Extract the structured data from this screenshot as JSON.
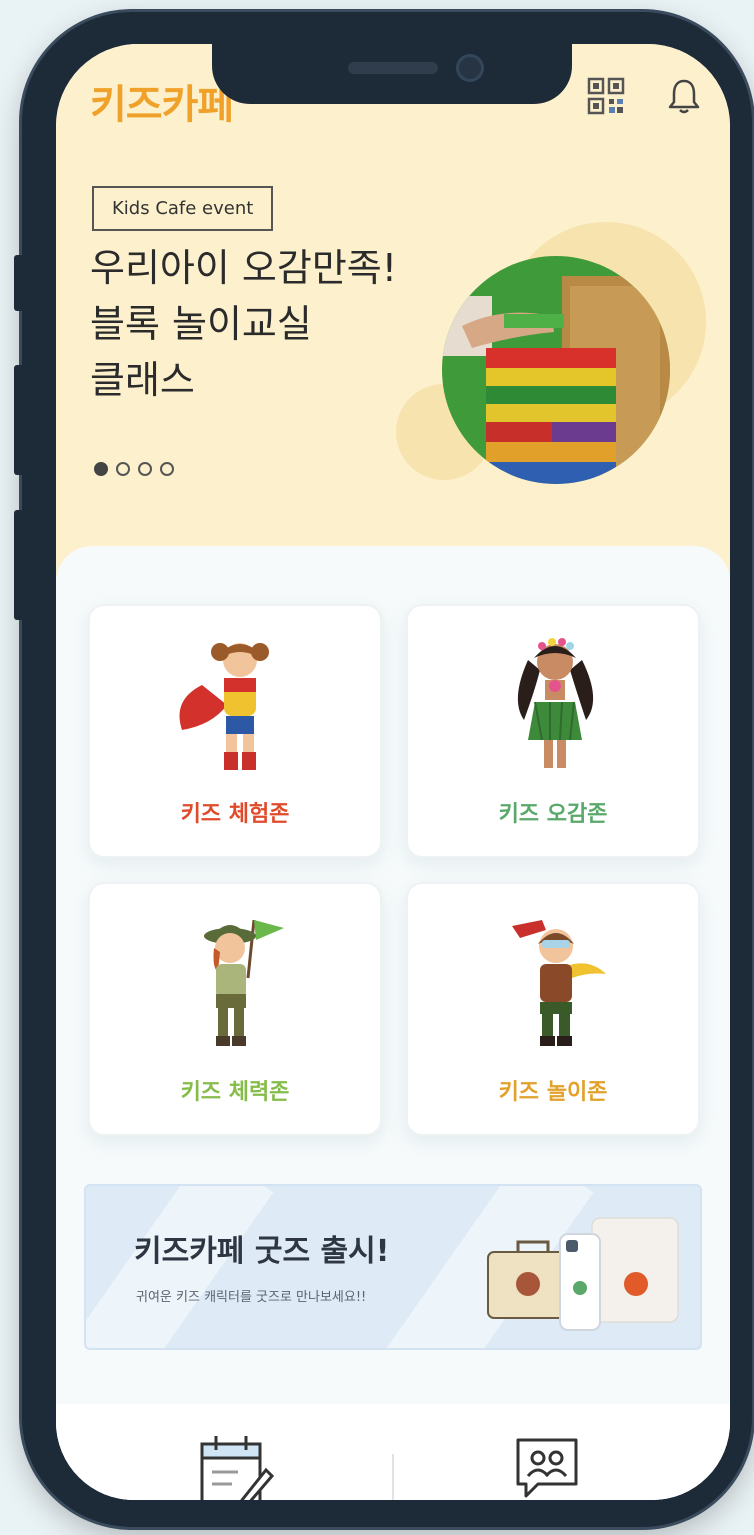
{
  "header": {
    "logo": "키즈카페",
    "qr_icon": "qr-code-icon",
    "bell_icon": "bell-icon"
  },
  "hero": {
    "tag": "Kids Cafe event",
    "title_lines": [
      "우리아이 오감만족!",
      "블록 놀이교실",
      "클래스"
    ],
    "carousel": {
      "total": 4,
      "active": 1
    },
    "photo": "block-tower-photo"
  },
  "zones": [
    {
      "label": "키즈 체험존",
      "color": "#e04b2c",
      "figure": "superhero-girl-icon"
    },
    {
      "label": "키즈 오감존",
      "color": "#5aa86a",
      "figure": "hula-girl-icon"
    },
    {
      "label": "키즈 체력존",
      "color": "#86bd4a",
      "figure": "scout-girl-icon"
    },
    {
      "label": "키즈 놀이존",
      "color": "#e2a12a",
      "figure": "pilot-boy-icon"
    }
  ],
  "goods": {
    "title": "키즈카페 굿즈 출시!",
    "subtitle": "귀여운 키즈 캐릭터를 굿즈로 만나보세요!!"
  },
  "bottom_nav": {
    "left_icon": "calendar-pen-icon",
    "right_icon": "chat-people-icon"
  },
  "colors": {
    "hero_bg": "#fcf0cd",
    "brand": "#f0a12a",
    "banner_bg": "#deebf6"
  }
}
